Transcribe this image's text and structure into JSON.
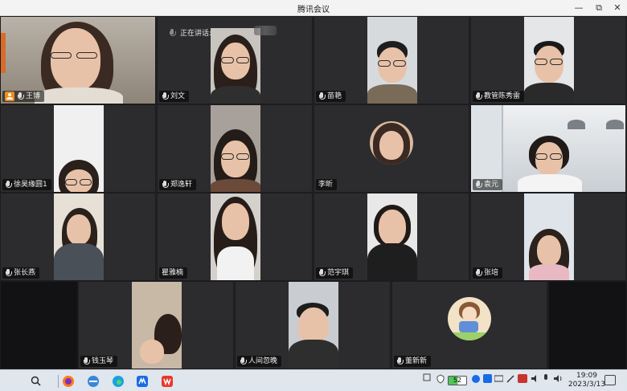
{
  "window": {
    "title": "腾讯会议",
    "minimize": "—",
    "maximize": "⧉",
    "close": "✕"
  },
  "speaking": {
    "label": "正在讲话:"
  },
  "participants": [
    {
      "name": "王博",
      "host": true
    },
    {
      "name": "刘文"
    },
    {
      "name": "苗艳"
    },
    {
      "name": "教管陈秀雷"
    },
    {
      "name": "徐昊缘圆1"
    },
    {
      "name": "郑逸轩"
    },
    {
      "name": "李昕"
    },
    {
      "name": "袁元"
    },
    {
      "name": "张长燕"
    },
    {
      "name": "瞿雅楠"
    },
    {
      "name": "范宇琪"
    },
    {
      "name": "张培"
    },
    {
      "name": "钱玉琴"
    },
    {
      "name": "人间忽晚"
    },
    {
      "name": "董新新"
    }
  ],
  "taskbar": {
    "battery": "52",
    "time": "19:09",
    "date": "2023/3/13",
    "icons": [
      "windows-icon",
      "search-icon",
      "firefox-icon",
      "ie-icon",
      "edge-icon",
      "tencent-meeting-icon",
      "wps-icon"
    ]
  }
}
